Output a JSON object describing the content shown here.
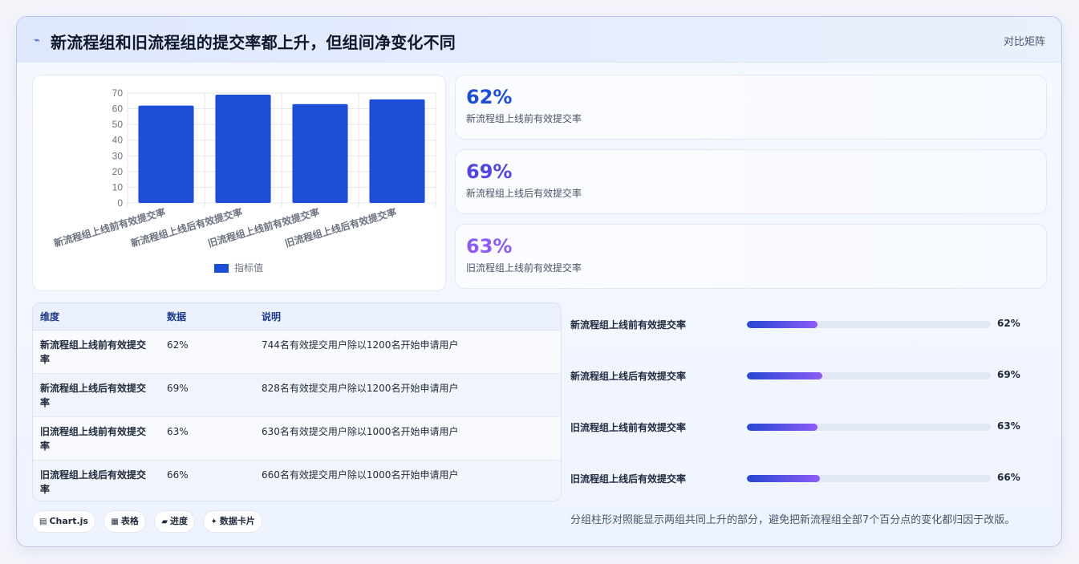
{
  "header": {
    "icon": "bolt-icon",
    "title": "新流程组和旧流程组的提交率都上升，但组间净变化不同",
    "tag": "对比矩阵"
  },
  "chart_data": {
    "type": "bar",
    "categories": [
      "新流程组上线前有效提交率",
      "新流程组上线后有效提交率",
      "旧流程组上线前有效提交率",
      "旧流程组上线后有效提交率"
    ],
    "series": [
      {
        "name": "指标值",
        "values": [
          62,
          69,
          63,
          66
        ]
      }
    ],
    "ylim": [
      0,
      70
    ],
    "yticks": [
      0,
      10,
      20,
      30,
      40,
      50,
      60,
      70
    ],
    "grid": true,
    "legend": "bottom",
    "color": "#1d4ed8"
  },
  "stats": [
    {
      "value": "62%",
      "label": "新流程组上线前有效提交率",
      "color": "#1d4ed8"
    },
    {
      "value": "69%",
      "label": "新流程组上线后有效提交率",
      "color": "#4f46e5"
    },
    {
      "value": "63%",
      "label": "旧流程组上线前有效提交率",
      "color": "#8b5cf6"
    }
  ],
  "table": {
    "headers": [
      "维度",
      "数据",
      "说明"
    ],
    "rows": [
      {
        "dim": "新流程组上线前有效提交率",
        "value": "62%",
        "note": "744名有效提交用户除以1200名开始申请用户"
      },
      {
        "dim": "新流程组上线后有效提交率",
        "value": "69%",
        "note": "828名有效提交用户除以1200名开始申请用户"
      },
      {
        "dim": "旧流程组上线前有效提交率",
        "value": "63%",
        "note": "630名有效提交用户除以1000名开始申请用户"
      },
      {
        "dim": "旧流程组上线后有效提交率",
        "value": "66%",
        "note": "660名有效提交用户除以1000名开始申请用户"
      }
    ]
  },
  "progress": [
    {
      "label": "新流程组上线前有效提交率",
      "value": "62%",
      "fraction": 0.29
    },
    {
      "label": "新流程组上线后有效提交率",
      "value": "69%",
      "fraction": 0.31
    },
    {
      "label": "旧流程组上线前有效提交率",
      "value": "63%",
      "fraction": 0.29
    },
    {
      "label": "旧流程组上线后有效提交率",
      "value": "66%",
      "fraction": 0.3
    }
  ],
  "chips": [
    {
      "icon": "chart-icon",
      "glyph": "▤",
      "label": "Chart.js"
    },
    {
      "icon": "table-icon",
      "glyph": "▦",
      "label": "表格"
    },
    {
      "icon": "progress-icon",
      "glyph": "▰",
      "label": "进度"
    },
    {
      "icon": "sparkle-icon",
      "glyph": "✦",
      "label": "数据卡片"
    }
  ],
  "note": "分组柱形对照能显示两组共同上升的部分，避免把新流程组全部7个百分点的变化都归因于改版。"
}
